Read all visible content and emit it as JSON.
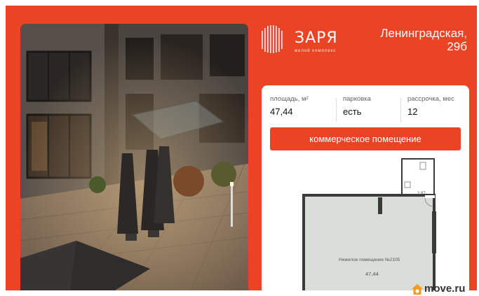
{
  "logo": {
    "name": "ЗАРЯ",
    "subtitle": "жилой комплекс"
  },
  "address": {
    "line1": "Ленинградская,",
    "line2": "29б"
  },
  "stats": [
    {
      "label": "площадь, м²",
      "value": "47,44"
    },
    {
      "label": "парковка",
      "value": "есть"
    },
    {
      "label": "рассрочка, мес",
      "value": "12"
    }
  ],
  "type_button": "коммерческое помещение",
  "plan": {
    "room_label": "Нежилое помещение №2105",
    "room_area": "47,44",
    "small_room_area": "2,87"
  },
  "brand": "move.ru",
  "colors": {
    "accent": "#ea4425",
    "plan_fill": "#d9dfd8",
    "plan_wall": "#3a3a3a"
  }
}
